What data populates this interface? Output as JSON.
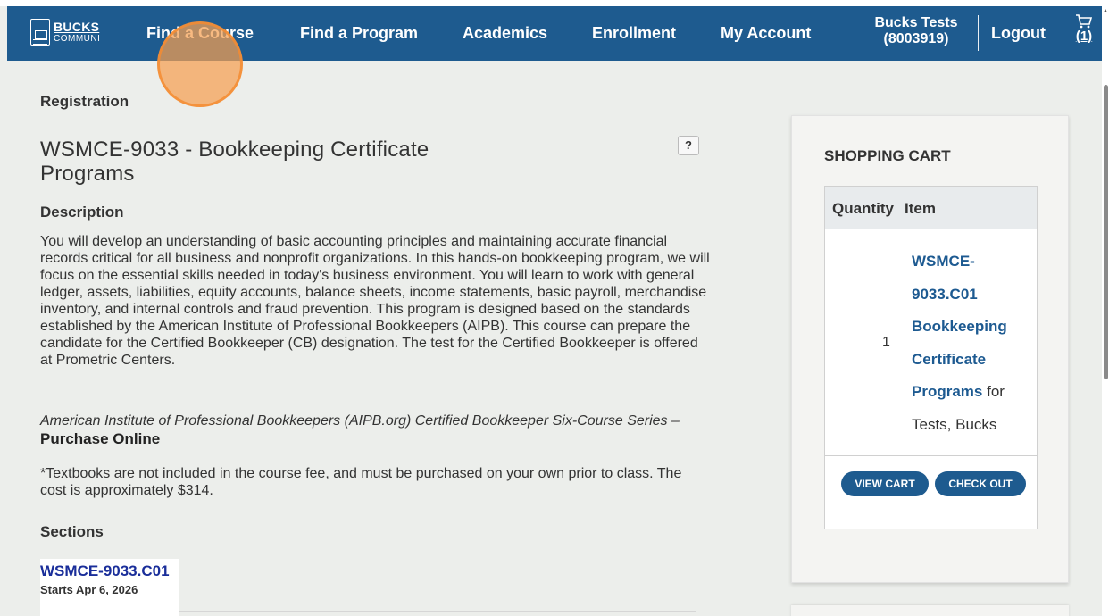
{
  "nav": {
    "logo_line1": "BUCKS",
    "logo_line2": "COMMUNI",
    "items": [
      "Find a Course",
      "Find a Program",
      "Academics",
      "Enrollment",
      "My Account"
    ],
    "user_name": "Bucks Tests",
    "user_id": "(8003919)",
    "logout": "Logout",
    "cart_count": "(1)"
  },
  "breadcrumb": "Registration",
  "course": {
    "title": "WSMCE-9033 - Bookkeeping Certificate Programs",
    "help": "?",
    "description_heading": "Description",
    "description": "You will develop an understanding of basic accounting principles and maintaining accurate financial records critical for all business and nonprofit organizations. In this hands-on bookkeeping program, we will focus on the essential skills needed in today's business environment. You will learn to work with general ledger, assets, liabilities, equity accounts, balance sheets, income statements, basic payroll, merchandise inventory, and internal controls and fraud prevention. This program is designed based on the standards established by the American Institute of Professional Bookkeepers (AIPB). This course can prepare the candidate for the Certified Bookkeeper (CB) designation. The test for the Certified Bookkeeper is offered at Prometric Centers.",
    "aipb_text": "American Institute of Professional Bookkeepers (AIPB.org) Certified Bookkeeper Six-Course Series – ",
    "purchase_link": "Purchase Online",
    "textbooks": "*Textbooks are not included in the course fee, and must be purchased on your own prior to class. The cost is approximately $314.",
    "sections_heading": "Sections",
    "section_code": "WSMCE-9033.C01",
    "section_start": "Starts Apr 6, 2026"
  },
  "cart": {
    "title": "SHOPPING CART",
    "col_quantity": "Quantity",
    "col_item": "Item",
    "quantity": "1",
    "item_link": "WSMCE-9033.C01 Bookkeeping Certificate Programs",
    "item_suffix": " for Tests, Bucks",
    "view_cart": "VIEW CART",
    "check_out": "CHECK OUT"
  },
  "colors": {
    "navbar": "#1e5b8f",
    "link": "#1d5a91",
    "section_code": "#1a2e9a",
    "background": "#eceeeb"
  },
  "icons": [
    "cart-icon",
    "help-icon"
  ]
}
